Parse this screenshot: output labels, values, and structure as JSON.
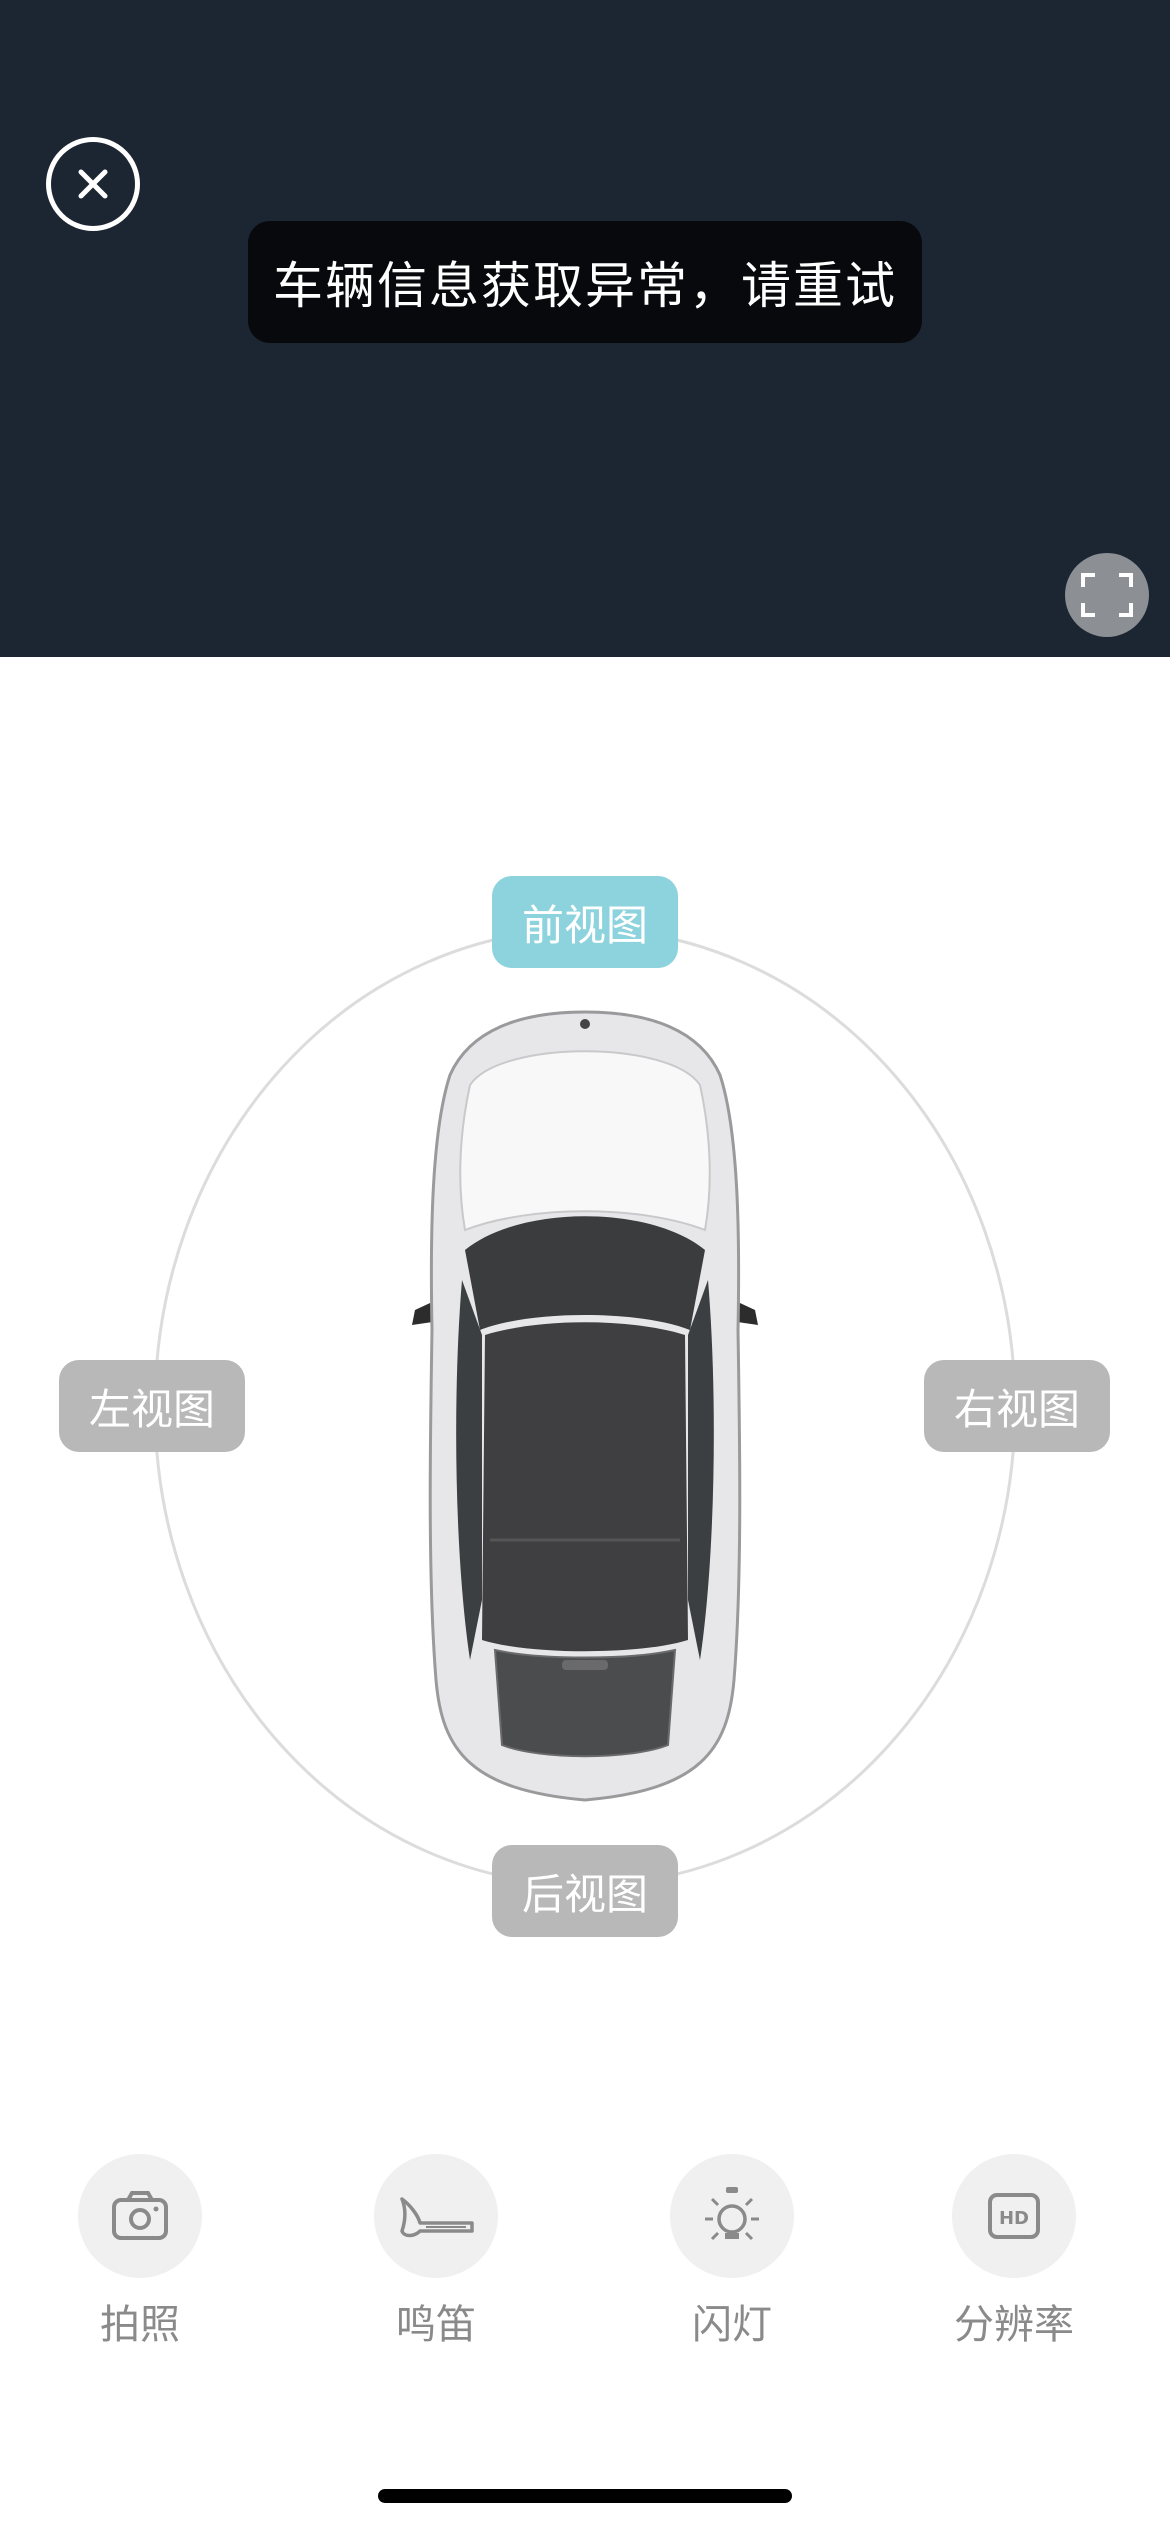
{
  "header": {
    "background_color": "#1c2532",
    "close_icon": "close-circle-icon",
    "fullscreen_icon": "fullscreen-icon"
  },
  "toast": {
    "message": "车辆信息获取异常，请重试"
  },
  "views": {
    "front": "前视图",
    "left": "左视图",
    "right": "右视图",
    "rear": "后视图",
    "active": "front",
    "active_color": "#8dd3dd",
    "inactive_color": "#b8b8b8"
  },
  "controls": [
    {
      "label": "拍照",
      "icon": "camera-icon"
    },
    {
      "label": "鸣笛",
      "icon": "horn-icon"
    },
    {
      "label": "闪灯",
      "icon": "light-icon"
    },
    {
      "label": "分辨率",
      "icon": "hd-icon"
    }
  ]
}
